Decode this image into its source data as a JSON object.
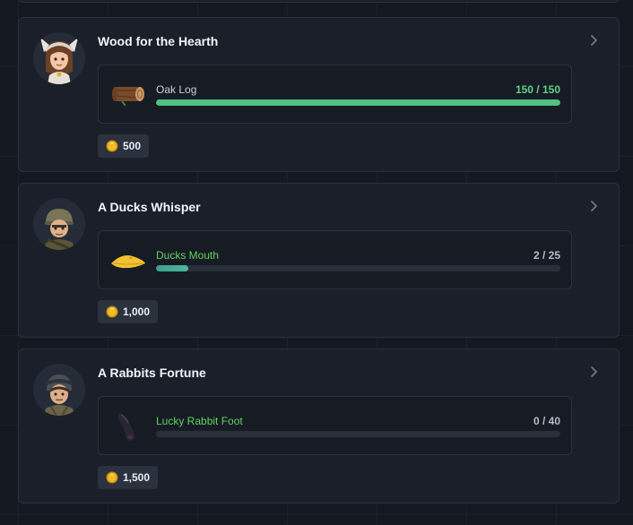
{
  "colors": {
    "background": "#141821",
    "card": "#1b1f29",
    "progress_complete": "#4fc283",
    "progress_partial": "#3e9f8c",
    "item_name_highlight": "#5fd35a",
    "coin": "#e8b321"
  },
  "quests": [
    {
      "title": "Wood for the Hearth",
      "avatar_icon": "viking-girl-avatar-icon",
      "item": {
        "name": "Oak Log",
        "icon": "oak-log-icon",
        "count": "150 / 150",
        "progress": 1.0
      },
      "reward": {
        "icon": "coin-icon",
        "amount": "500"
      }
    },
    {
      "title": "A Ducks Whisper",
      "avatar_icon": "soldier-avatar-icon",
      "item": {
        "name": "Ducks Mouth",
        "icon": "duck-bill-icon",
        "count": "2 / 25",
        "progress": 0.08
      },
      "reward": {
        "icon": "coin-icon",
        "amount": "1,000"
      }
    },
    {
      "title": "A Rabbits Fortune",
      "avatar_icon": "ranger-avatar-icon",
      "item": {
        "name": "Lucky Rabbit Foot",
        "icon": "rabbit-foot-icon",
        "count": "0 / 40",
        "progress": 0.0
      },
      "reward": {
        "icon": "coin-icon",
        "amount": "1,500"
      }
    }
  ]
}
